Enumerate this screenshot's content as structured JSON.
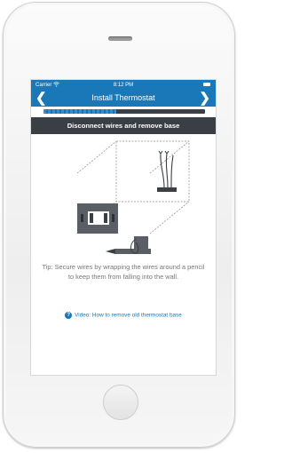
{
  "status_bar": {
    "carrier": "Carrier",
    "time": "8:12 PM",
    "wifi_icon": "wifi-icon",
    "battery_icon": "battery-icon"
  },
  "nav": {
    "title": "Install Thermostat",
    "back_icon": "chevron-left-icon",
    "forward_icon": "chevron-right-icon"
  },
  "progress": {
    "fraction": 0.45
  },
  "step": {
    "heading": "Disconnect wires and remove base"
  },
  "tip": {
    "text": "Tip: Secure wires by wrapping the wires around a pencil to keep them from falling into the wall."
  },
  "video_link": {
    "icon": "question-circle-icon",
    "label": "Video: How to remove old thermostat base"
  },
  "colors": {
    "accent": "#1a78b8",
    "banner": "#3a3f45",
    "tip_text": "#777777"
  }
}
